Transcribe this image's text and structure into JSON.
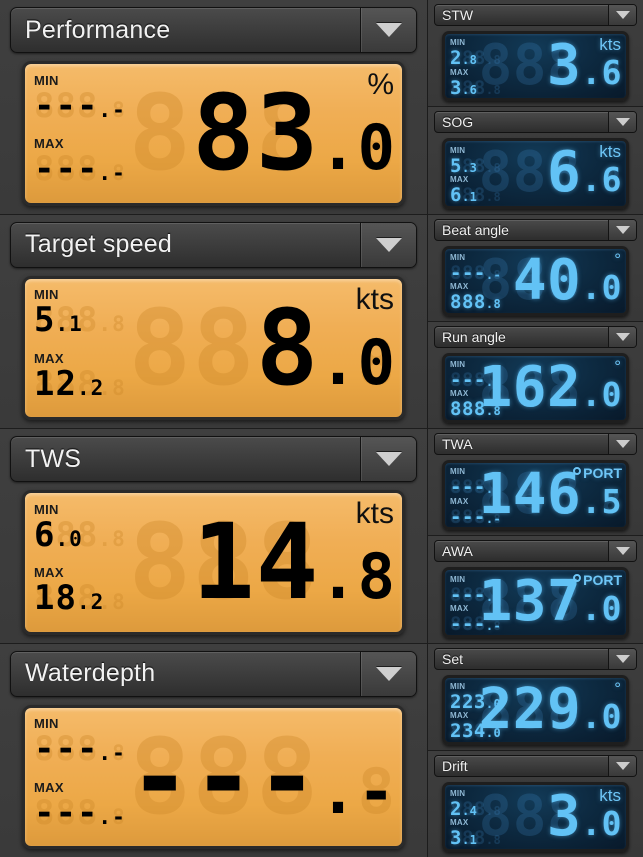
{
  "theme": {
    "orange_lcd": "#f0ae55",
    "orange_digit_on": "#000000",
    "orange_digit_ghost": "#cd882a",
    "blue_lcd": "#0d2a41",
    "blue_digit_on": "#62c2f5",
    "blue_digit_ghost": "#4696d7",
    "panel_bg": "#3a3a3a",
    "header_text": "#f2f2f2"
  },
  "dropdown_icon": "chevron-down-icon",
  "left_panels": [
    {
      "title": "Performance",
      "unit": "%",
      "unit_type": "percent",
      "min_label": "MIN",
      "max_label": "MAX",
      "min_ghost": "888",
      "min_ghost_dec": ".8",
      "min_value": "---",
      "min_value_dec": ".-",
      "max_ghost": "888",
      "max_ghost_dec": ".8",
      "max_value": "---",
      "max_value_dec": ".-",
      "big_ghost": "888",
      "big_ghost_dec": ".8",
      "big_value": " 83",
      "big_value_dec": ".0"
    },
    {
      "title": "Target speed",
      "unit": "kts",
      "unit_type": "text",
      "min_label": "MIN",
      "max_label": "MAX",
      "min_ghost": "888",
      "min_ghost_dec": ".8",
      "min_value": "  5",
      "min_value_dec": ".1",
      "max_ghost": "888",
      "max_ghost_dec": ".8",
      "max_value": " 12",
      "max_value_dec": ".2",
      "big_ghost": "888",
      "big_ghost_dec": ".8",
      "big_value": "  8",
      "big_value_dec": ".0"
    },
    {
      "title": "TWS",
      "unit": "kts",
      "unit_type": "text",
      "min_label": "MIN",
      "max_label": "MAX",
      "min_ghost": "888",
      "min_ghost_dec": ".8",
      "min_value": "  6",
      "min_value_dec": ".0",
      "max_ghost": "888",
      "max_ghost_dec": ".8",
      "max_value": " 18",
      "max_value_dec": ".2",
      "big_ghost": "888",
      "big_ghost_dec": ".8",
      "big_value": " 14",
      "big_value_dec": ".8"
    },
    {
      "title": "Waterdepth",
      "unit": "",
      "unit_type": "none",
      "min_label": "MIN",
      "max_label": "MAX",
      "min_ghost": "888",
      "min_ghost_dec": ".8",
      "min_value": "---",
      "min_value_dec": ".-",
      "max_ghost": "888",
      "max_ghost_dec": ".8",
      "max_value": "---",
      "max_value_dec": ".-",
      "big_ghost": "888",
      "big_ghost_dec": ".8",
      "big_value": "---",
      "big_value_dec": ".-"
    }
  ],
  "right_panels": [
    {
      "title": "STW",
      "unit": "kts",
      "unit_type": "text",
      "min_label": "MIN",
      "max_label": "MAX",
      "min_ghost": "888",
      "min_ghost_dec": ".8",
      "min_value": " 2",
      "min_value_dec": ".8",
      "max_ghost": "888",
      "max_ghost_dec": ".8",
      "max_value": " 3",
      "max_value_dec": ".6",
      "big_ghost": "888",
      "big_ghost_dec": ".8",
      "big_value": "  3",
      "big_value_dec": ".6"
    },
    {
      "title": "SOG",
      "unit": "kts",
      "unit_type": "text",
      "min_label": "MIN",
      "max_label": "MAX",
      "min_ghost": "888",
      "min_ghost_dec": ".8",
      "min_value": " 5",
      "min_value_dec": ".3",
      "max_ghost": "888",
      "max_ghost_dec": ".8",
      "max_value": " 6",
      "max_value_dec": ".1",
      "big_ghost": "888",
      "big_ghost_dec": ".8",
      "big_value": "  6",
      "big_value_dec": ".6"
    },
    {
      "title": "Beat angle",
      "unit": "°",
      "unit_type": "degree",
      "min_label": "MIN",
      "max_label": "MAX",
      "min_ghost": "888",
      "min_ghost_dec": ".8",
      "min_value": "---",
      "min_value_dec": ".-",
      "max_ghost": "888",
      "max_ghost_dec": ".8",
      "max_value": "888",
      "max_value_dec": ".8",
      "big_ghost": "888",
      "big_ghost_dec": ".8",
      "big_value": " 40",
      "big_value_dec": ".0"
    },
    {
      "title": "Run angle",
      "unit": "°",
      "unit_type": "degree",
      "min_label": "MIN",
      "max_label": "MAX",
      "min_ghost": "888",
      "min_ghost_dec": ".8",
      "min_value": "---",
      "min_value_dec": ".-",
      "max_ghost": "888",
      "max_ghost_dec": ".8",
      "max_value": "888",
      "max_value_dec": ".8",
      "big_ghost": "888",
      "big_ghost_dec": ".8",
      "big_value": "162",
      "big_value_dec": ".0"
    },
    {
      "title": "TWA",
      "unit": "PORT",
      "unit_type": "port",
      "min_label": "MIN",
      "max_label": "MAX",
      "min_ghost": "888",
      "min_ghost_dec": ".8",
      "min_value": "---",
      "min_value_dec": ".-",
      "max_ghost": "888",
      "max_ghost_dec": ".8",
      "max_value": "---",
      "max_value_dec": ".-",
      "big_ghost": "888",
      "big_ghost_dec": ".8",
      "big_value": "146",
      "big_value_dec": ".5"
    },
    {
      "title": "AWA",
      "unit": "PORT",
      "unit_type": "port",
      "min_label": "MIN",
      "max_label": "MAX",
      "min_ghost": "888",
      "min_ghost_dec": ".8",
      "min_value": "---",
      "min_value_dec": ".-",
      "max_ghost": "888",
      "max_ghost_dec": ".8",
      "max_value": "---",
      "max_value_dec": ".-",
      "big_ghost": "888",
      "big_ghost_dec": ".8",
      "big_value": "137",
      "big_value_dec": ".0"
    },
    {
      "title": "Set",
      "unit": "°",
      "unit_type": "degree",
      "min_label": "MIN",
      "max_label": "MAX",
      "min_ghost": "888",
      "min_ghost_dec": ".8",
      "min_value": "223",
      "min_value_dec": ".0",
      "max_ghost": "888",
      "max_ghost_dec": ".8",
      "max_value": "234",
      "max_value_dec": ".0",
      "big_ghost": "888",
      "big_ghost_dec": ".8",
      "big_value": "229",
      "big_value_dec": ".0"
    },
    {
      "title": "Drift",
      "unit": "kts",
      "unit_type": "text",
      "min_label": "MIN",
      "max_label": "MAX",
      "min_ghost": "888",
      "min_ghost_dec": ".8",
      "min_value": " 2",
      "min_value_dec": ".4",
      "max_ghost": "888",
      "max_ghost_dec": ".8",
      "max_value": " 3",
      "max_value_dec": ".1",
      "big_ghost": "888",
      "big_ghost_dec": ".8",
      "big_value": "  3",
      "big_value_dec": ".0"
    }
  ]
}
